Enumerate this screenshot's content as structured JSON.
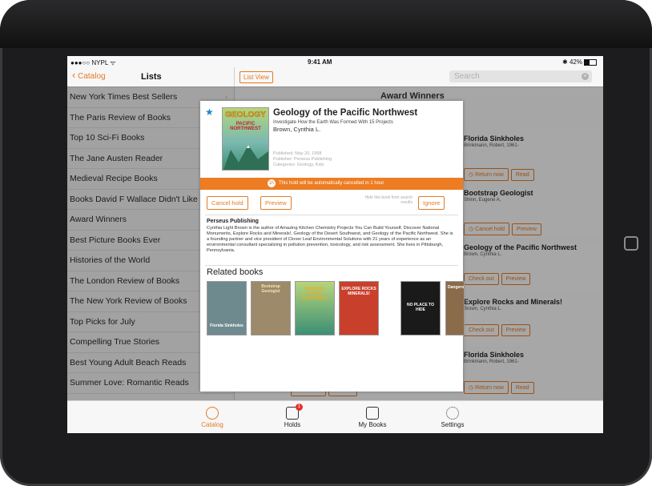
{
  "status": {
    "carrier": "●●●○○ NYPL ᯤ",
    "time": "9:41 AM",
    "battery": "42%"
  },
  "left": {
    "back_label": "Catalog",
    "title": "Lists",
    "items": [
      "New York Times Best Sellers",
      "The Paris Review of Books",
      "Top 10 Sci-Fi Books",
      "The Jane Austen Reader",
      "Medieval Recipe Books",
      "Books David F Wallace Didn't Like",
      "Award Winners",
      "Best Picture Books Ever",
      "Histories of the World",
      "The London Review of Books",
      "The New York Review of Books",
      "Top Picks for July",
      "Compelling True Stories",
      "Best Young Adult Beach Reads",
      "Summer Love: Romantic Reads"
    ]
  },
  "right": {
    "list_view_label": "List View",
    "search_placeholder": "Search",
    "section_title": "Award Winners",
    "cards": [
      {
        "title": "Florida Sinkholes",
        "author": "Brinkmann, Robert, 1961-",
        "buttons": [
          "Return now",
          "Read"
        ]
      },
      {
        "title": "Bootstrap Geologist",
        "author": "Shinn, Eugene A.",
        "buttons": [
          "Cancel hold",
          "Preview"
        ]
      },
      {
        "title": "Geology of the Pacific Northwest",
        "author": "Brown, Cynthia L.",
        "buttons": [
          "Check out",
          "Preview"
        ]
      },
      {
        "title": "Explore Rocks and Minerals!",
        "author": "Brown, Cynthia L.",
        "buttons": [
          "Check out",
          "Preview"
        ]
      },
      {
        "title": "Florida Sinkholes",
        "author": "Brinkmann, Robert, 1961-",
        "buttons": [
          "Return now",
          "Read"
        ]
      }
    ],
    "bottom_left_buttons": [
      "Check out",
      "Preview"
    ]
  },
  "modal": {
    "title": "Geology of the Pacific Northwest",
    "subtitle": "Investigate How the Earth Was Formed With 15 Projects",
    "author": "Brown, Cynthia L.",
    "published": "Published: May 20, 1998",
    "publisher": "Publisher: Perseus Publishing",
    "categories": "Categories: Geology, Kids",
    "cover_line1": "GEOLOGY",
    "cover_line2": "PACIFIC NORTHWEST",
    "banner": "This hold will be automatically cancelled in 1 hour",
    "banner_clock": "1h",
    "cancel_label": "Cancel hold",
    "preview_label": "Preview",
    "hide_text": "Hide this book from search results",
    "ignore_label": "Ignore",
    "publisher_name": "Perseus Publishing",
    "description": "Cynthia Light Brown is the author of Amazing Kitchen Chemistry Projects You Can Build Yourself, Discover National Monuments, Explore Rocks and Minerals!, Geology of the Desert Southwest, and Geology of the Pacific Northwest. She is a founding partner and vice president of Clover Leaf Environmental Solutions with 21 years of experience as an environmental consultant specializing in pollution prevention, toxicology, and risk assessment. She lives in Pittsburgh, Pennsylvania.",
    "related_title": "Related books",
    "related": [
      {
        "label": "Florida Sinkholes",
        "color": "#6f8a8f"
      },
      {
        "label": "Bootstrap Geologist",
        "color": "#9c8a6a"
      },
      {
        "label": "GEOLOGY PACIFIC NORTHWEST",
        "color": "#7bb9b0"
      },
      {
        "label": "EXPLORE ROCKS MINERALS!",
        "color": "#c8402b"
      },
      {
        "label": "NO PLACE TO HIDE",
        "color": "#1a1a1a"
      },
      {
        "label": "Dangerous",
        "color": "#8a6b4a"
      }
    ]
  },
  "tabs": [
    {
      "label": "Catalog",
      "icon": "catalog-icon",
      "active": true
    },
    {
      "label": "Holds",
      "icon": "holds-icon",
      "badge": "1"
    },
    {
      "label": "My Books",
      "icon": "my-books-icon"
    },
    {
      "label": "Settings",
      "icon": "gear-icon"
    }
  ],
  "colors": {
    "accent": "#e57a24",
    "banner": "#ed7c22",
    "star": "#1f86c8",
    "badge": "#e5322c"
  }
}
